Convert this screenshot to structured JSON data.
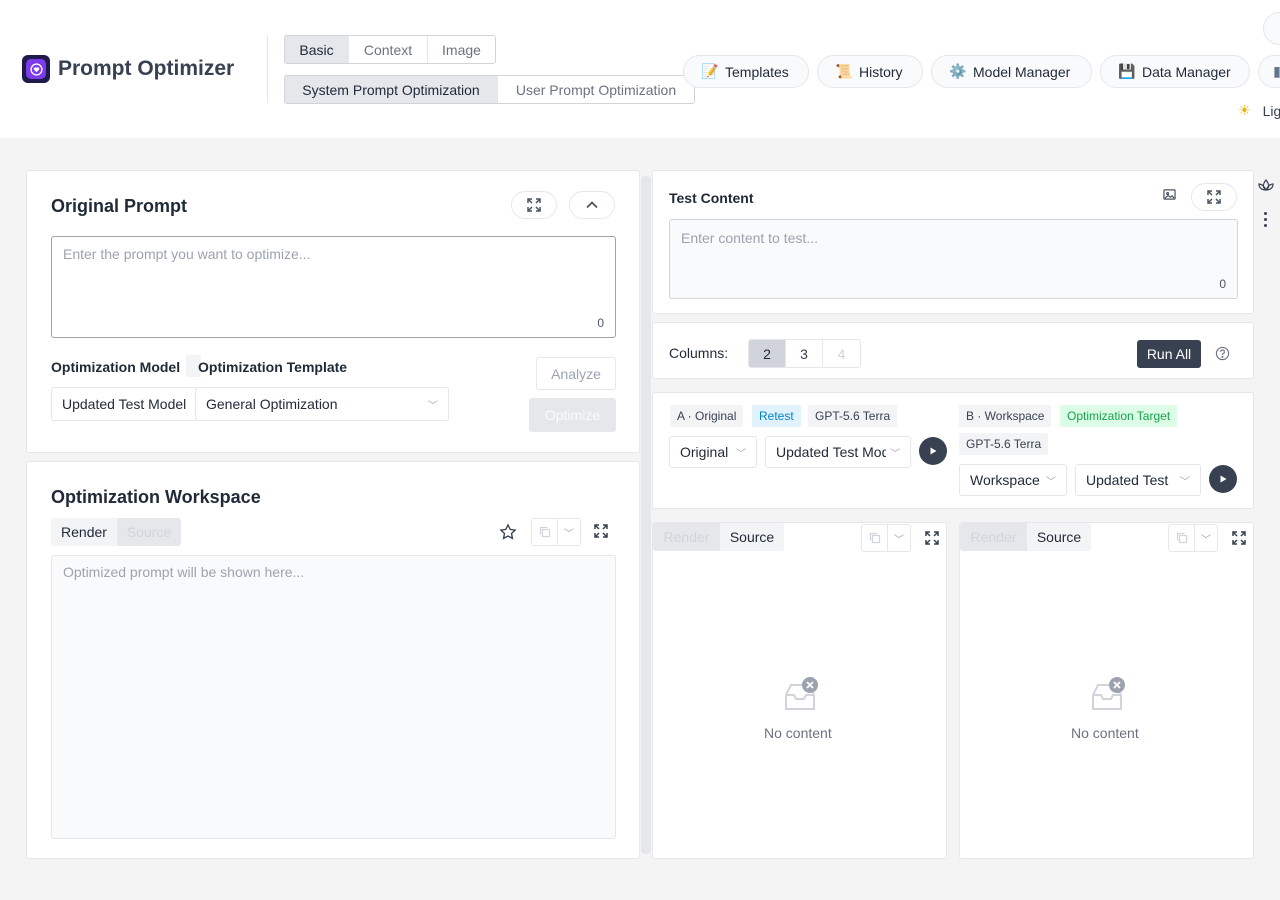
{
  "header": {
    "app_title": "Prompt Optimizer",
    "mode_tabs": [
      "Basic",
      "Context",
      "Image"
    ],
    "sub_tabs": [
      "System Prompt Optimization",
      "User Prompt Optimization"
    ],
    "nav": {
      "templates": "Templates",
      "history": "History",
      "model_manager": "Model Manager",
      "data_manager": "Data Manager"
    },
    "theme_label": "Lig"
  },
  "original_prompt": {
    "title": "Original Prompt",
    "placeholder": "Enter the prompt you want to optimize...",
    "count": "0",
    "model_label": "Optimization Model",
    "template_label": "Optimization Template",
    "model_value": "Updated Test Model",
    "template_value": "General Optimization",
    "analyze": "Analyze",
    "optimize": "Optimize"
  },
  "workspace": {
    "title": "Optimization Workspace",
    "tab_render": "Render",
    "tab_source": "Source",
    "placeholder": "Optimized prompt will be shown here..."
  },
  "test_content": {
    "title": "Test Content",
    "placeholder": "Enter content to test...",
    "count": "0"
  },
  "columns": {
    "label": "Columns:",
    "options": [
      "2",
      "3",
      "4"
    ],
    "run_all": "Run All"
  },
  "column_a": {
    "tag": "A · Original",
    "retest": "Retest",
    "model_tag": "GPT-5.6 Terra",
    "source_select": "Original",
    "model_select": "Updated Test Model"
  },
  "column_b": {
    "tag": "B · Workspace",
    "target": "Optimization Target",
    "model_tag": "GPT-5.6 Terra",
    "source_select": "Workspace",
    "model_select": "Updated Test"
  },
  "results": {
    "tab_render": "Render",
    "tab_source": "Source",
    "empty": "No content"
  },
  "colors": {
    "accent_dark": "#374151",
    "logo": "#7c3aed",
    "retest": "#0284c7",
    "target": "#16a34a"
  }
}
